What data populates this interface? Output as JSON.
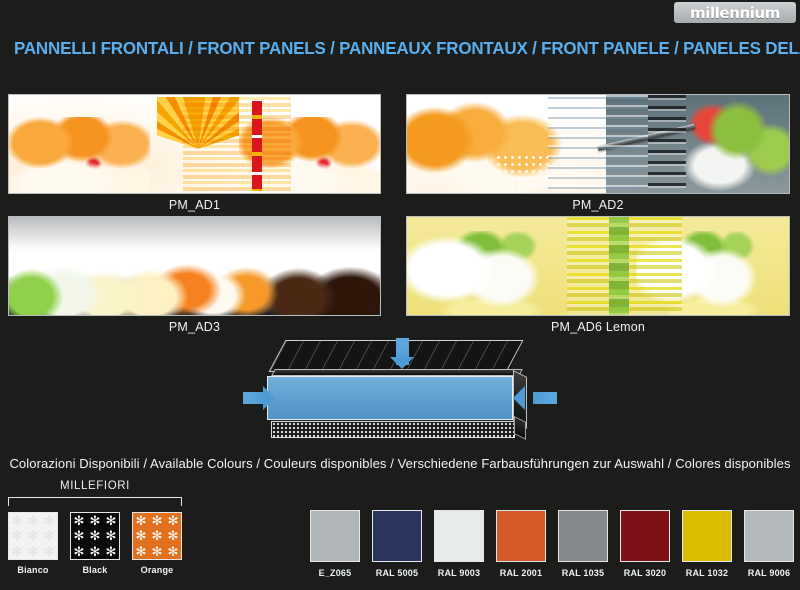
{
  "logo": {
    "text": "millennium"
  },
  "header": {
    "title": "PANNELLI FRONTALI / FRONT PANELS / PANNEAUX FRONTAUX / FRONT PANELE / PANELES DELANTEROS",
    "title_color": "#59aff0"
  },
  "panels": [
    {
      "id": "pm-ad1",
      "caption": "PM_AD1",
      "art": "peaches-orange-sunburst"
    },
    {
      "id": "pm-ad2",
      "caption": "PM_AD2",
      "art": "food-collage-knife"
    },
    {
      "id": "pm-ad3",
      "caption": "PM_AD3",
      "art": "gelato-row-mint-to-chocolate"
    },
    {
      "id": "pm-ad6",
      "caption": "PM_AD6 Lemon",
      "art": "lemon-cream"
    }
  ],
  "diagram": {
    "name": "display-case-front-panel-diagram",
    "panel_color": "#5c9fd0",
    "arrow_color": "#4f9bd4",
    "arrows": [
      "arrow-down",
      "arrow-left",
      "arrow-right"
    ]
  },
  "colours_section": {
    "heading": "Colorazioni Disponibili / Available Colours / Couleurs disponibles / Verschiedene Farbausführungen zur Auswahl / Colores disponibles"
  },
  "millefiori": {
    "title": "MILLEFIORI",
    "flower_glyph": "✻",
    "swatches": [
      {
        "label": "Bianco",
        "bg": "#f2f2f2",
        "flower": "#e2e2e2"
      },
      {
        "label": "Black",
        "bg": "#0b0b0b",
        "flower": "#ffffff"
      },
      {
        "label": "Orange",
        "bg": "#e2701e",
        "flower": "#ffffff"
      }
    ]
  },
  "ral_swatches": [
    {
      "label": "E_Z065",
      "color": "#b0b5b8"
    },
    {
      "label": "RAL 5005",
      "color": "#2b355c"
    },
    {
      "label": "RAL 9003",
      "color": "#e6eaeb"
    },
    {
      "label": "RAL 2001",
      "color": "#d35a28"
    },
    {
      "label": "RAL 1035",
      "color": "#85898b"
    },
    {
      "label": "RAL 3020",
      "color": "#7e1117"
    },
    {
      "label": "RAL 1032",
      "color": "#d9bc00"
    },
    {
      "label": "RAL 9006",
      "color": "#b4b9bc"
    }
  ]
}
